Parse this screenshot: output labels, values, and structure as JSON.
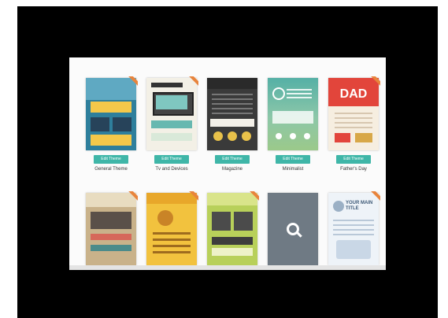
{
  "templates": [
    {
      "button": "Edit Theme",
      "name": "General Theme"
    },
    {
      "button": "Edit Theme",
      "name": "Tv and Devices"
    },
    {
      "button": "Edit Theme",
      "name": "Magazine"
    },
    {
      "button": "Edit Theme",
      "name": "Minimalist"
    },
    {
      "button": "Edit Theme",
      "name": "Father's Day"
    }
  ],
  "thumbnails": {
    "dad_text": "DAD",
    "placeholder_title": "YOUR MAIN TITLE"
  },
  "colors": {
    "accent": "#3fb6a8",
    "ribbon": "#e8843c",
    "background": "#000000"
  }
}
